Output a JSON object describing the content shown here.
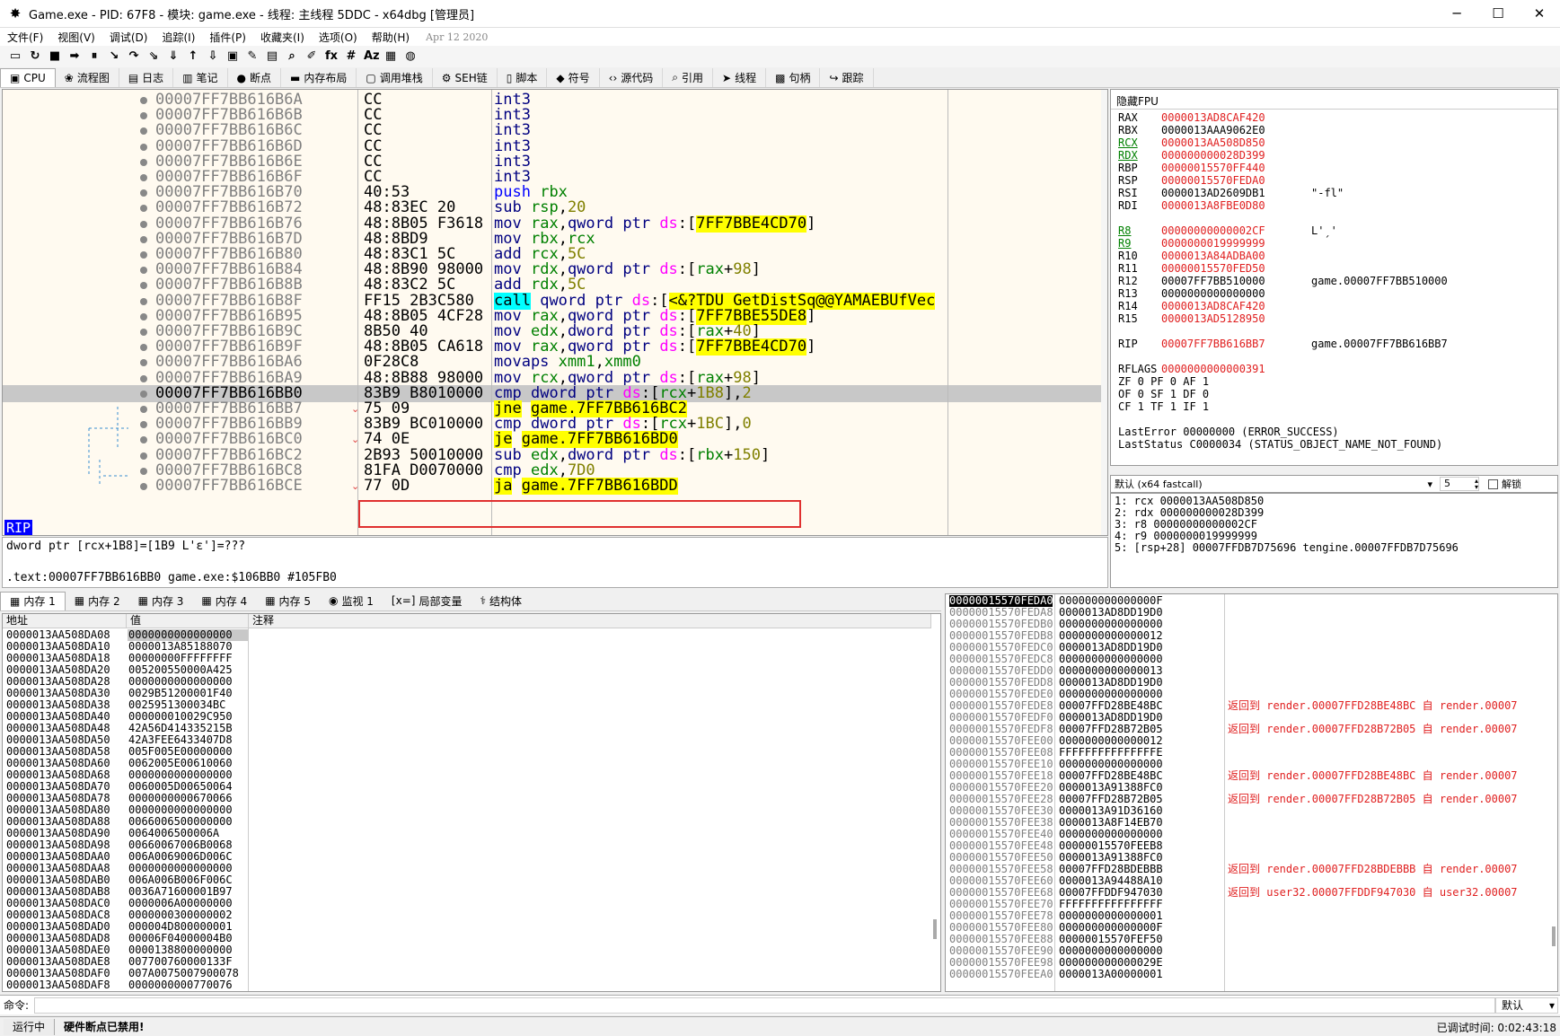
{
  "window": {
    "title": "Game.exe - PID: 67F8 - 模块: game.exe - 线程: 主线程 5DDC - x64dbg [管理员]",
    "minimize": "─",
    "maximize": "☐",
    "close": "✕"
  },
  "menu": {
    "items": [
      "文件(F)",
      "视图(V)",
      "调试(D)",
      "追踪(I)",
      "插件(P)",
      "收藏夹(I)",
      "选项(O)",
      "帮助(H)"
    ],
    "date": "Apr 12 2020"
  },
  "toolbar": {
    "icons": [
      "open-icon",
      "restart-icon",
      "stop-icon",
      "run-icon",
      "pause-icon",
      "step-into-icon",
      "step-over-icon",
      "trace-into-icon",
      "trace-over-icon",
      "execute-till-return-icon",
      "run-to-user-code-icon",
      "scylla-icon",
      "patch-icon",
      "comment-icon",
      "label-icon",
      "bookmark-icon",
      "function-icon",
      "hash-icon",
      "font-icon",
      "calculator-icon",
      "globe-icon"
    ],
    "glyphs": [
      "▭",
      "↻",
      "■",
      "➡",
      "⏸",
      "↘",
      "↷",
      "⇘",
      "⇓",
      "↑",
      "⇩",
      "▣",
      "✎",
      "▤",
      "⌕",
      "✐",
      "fx",
      "#",
      "Aᴢ",
      "▦",
      "◍"
    ]
  },
  "tabs": [
    {
      "label": "CPU",
      "icon": "▣"
    },
    {
      "label": "流程图",
      "icon": "❀"
    },
    {
      "label": "日志",
      "icon": "▤"
    },
    {
      "label": "笔记",
      "icon": "▥"
    },
    {
      "label": "断点",
      "icon": "●"
    },
    {
      "label": "内存布局",
      "icon": "▬"
    },
    {
      "label": "调用堆栈",
      "icon": "▢"
    },
    {
      "label": "SEH链",
      "icon": "⚙"
    },
    {
      "label": "脚本",
      "icon": "▯"
    },
    {
      "label": "符号",
      "icon": "◆"
    },
    {
      "label": "源代码",
      "icon": "‹›"
    },
    {
      "label": "引用",
      "icon": "⌕"
    },
    {
      "label": "线程",
      "icon": "➤"
    },
    {
      "label": "句柄",
      "icon": "▩"
    },
    {
      "label": "跟踪",
      "icon": "↪"
    }
  ],
  "disasm": [
    {
      "addr": "00007FF7BB616B6A",
      "bytes": "CC",
      "dis": "int3"
    },
    {
      "addr": "00007FF7BB616B6B",
      "bytes": "CC",
      "dis": "int3"
    },
    {
      "addr": "00007FF7BB616B6C",
      "bytes": "CC",
      "dis": "int3"
    },
    {
      "addr": "00007FF7BB616B6D",
      "bytes": "CC",
      "dis": "int3"
    },
    {
      "addr": "00007FF7BB616B6E",
      "bytes": "CC",
      "dis": "int3"
    },
    {
      "addr": "00007FF7BB616B6F",
      "bytes": "CC",
      "dis": "int3"
    },
    {
      "addr": "00007FF7BB616B70",
      "bytes": "40:53",
      "dis": "push rbx"
    },
    {
      "addr": "00007FF7BB616B72",
      "bytes": "48:83EC 20",
      "dis": "sub rsp,20"
    },
    {
      "addr": "00007FF7BB616B76",
      "bytes": "48:8B05 F3618",
      "dis": "mov rax,qword ptr ds:[7FF7BBE4CD70]"
    },
    {
      "addr": "00007FF7BB616B7D",
      "bytes": "48:8BD9",
      "dis": "mov rbx,rcx"
    },
    {
      "addr": "00007FF7BB616B80",
      "bytes": "48:83C1 5C",
      "dis": "add rcx,5C"
    },
    {
      "addr": "00007FF7BB616B84",
      "bytes": "48:8B90 98000",
      "dis": "mov rdx,qword ptr ds:[rax+98]"
    },
    {
      "addr": "00007FF7BB616B8B",
      "bytes": "48:83C2 5C",
      "dis": "add rdx,5C"
    },
    {
      "addr": "00007FF7BB616B8F",
      "bytes": "FF15 2B3C580",
      "dis": "call qword ptr ds:[<&?TDU_GetDistSq@@YAMAEBUfVec"
    },
    {
      "addr": "00007FF7BB616B95",
      "bytes": "48:8B05 4CF28",
      "dis": "mov rax,qword ptr ds:[7FF7BBE55DE8]"
    },
    {
      "addr": "00007FF7BB616B9C",
      "bytes": "8B50 40",
      "dis": "mov edx,dword ptr ds:[rax+40]"
    },
    {
      "addr": "00007FF7BB616B9F",
      "bytes": "48:8B05 CA618",
      "dis": "mov rax,qword ptr ds:[7FF7BBE4CD70]"
    },
    {
      "addr": "00007FF7BB616BA6",
      "bytes": "0F28C8",
      "dis": "movaps xmm1,xmm0"
    },
    {
      "addr": "00007FF7BB616BA9",
      "bytes": "48:8B88 98000",
      "dis": "mov rcx,qword ptr ds:[rax+98]"
    },
    {
      "addr": "00007FF7BB616BB0",
      "bytes": "83B9 B8010000",
      "dis": "cmp dword ptr ds:[rcx+1B8],2"
    },
    {
      "addr": "00007FF7BB616BB7",
      "bytes": "75 09",
      "dis": "jne game.7FF7BB616BC2"
    },
    {
      "addr": "00007FF7BB616BB9",
      "bytes": "83B9 BC010000",
      "dis": "cmp dword ptr ds:[rcx+1BC],0"
    },
    {
      "addr": "00007FF7BB616BC0",
      "bytes": "74 0E",
      "dis": "je game.7FF7BB616BD0"
    },
    {
      "addr": "00007FF7BB616BC2",
      "bytes": "2B93 50010000",
      "dis": "sub edx,dword ptr ds:[rbx+150]"
    },
    {
      "addr": "00007FF7BB616BC8",
      "bytes": "81FA D0070000",
      "dis": "cmp edx,7D0"
    },
    {
      "addr": "00007FF7BB616BCE",
      "bytes": "77 0D",
      "dis": "ja game.7FF7BB616BDD"
    }
  ],
  "rip_label": "RIP",
  "info": {
    "line1": "dword ptr [rcx+1B8]=[1B9 L'ε']=???",
    "line2": ".text:00007FF7BB616BB0 game.exe:$106BB0 #105FB0"
  },
  "regs": {
    "header": "隐藏FPU",
    "gp": [
      {
        "n": "RAX",
        "v": "0000013AD8CAF420",
        "c": ""
      },
      {
        "n": "RBX",
        "v": "0000013AAA9062E0",
        "c": ""
      },
      {
        "n": "RCX",
        "v": "0000013AA508D850",
        "c": ""
      },
      {
        "n": "RDX",
        "v": "000000000028D399",
        "c": ""
      },
      {
        "n": "RBP",
        "v": "00000015570FF440",
        "c": ""
      },
      {
        "n": "RSP",
        "v": "00000015570FEDA0",
        "c": ""
      },
      {
        "n": "RSI",
        "v": "0000013AD2609DB1",
        "c": "\"-fl\""
      },
      {
        "n": "RDI",
        "v": "0000013A8FBE0D80",
        "c": ""
      }
    ],
    "ext": [
      {
        "n": "R8",
        "v": "00000000000002CF",
        "c": "L'ˏ'"
      },
      {
        "n": "R9",
        "v": "0000000019999999",
        "c": ""
      },
      {
        "n": "R10",
        "v": "0000013A84ADBA00",
        "c": ""
      },
      {
        "n": "R11",
        "v": "00000015570FED50",
        "c": ""
      },
      {
        "n": "R12",
        "v": "00007FF7BB510000",
        "c": "game.00007FF7BB510000"
      },
      {
        "n": "R13",
        "v": "0000000000000000",
        "c": ""
      },
      {
        "n": "R14",
        "v": "0000013AD8CAF420",
        "c": ""
      },
      {
        "n": "R15",
        "v": "0000013AD5128950",
        "c": ""
      }
    ],
    "rip": {
      "n": "RIP",
      "v": "00007FF7BB616BB7",
      "c": "game.00007FF7BB616BB7"
    },
    "rflags": {
      "n": "RFLAGS",
      "v": "0000000000000391"
    },
    "flags": [
      "ZF 0   PF 0   AF 1",
      "OF 0   SF 1   DF 0",
      "CF 1   TF 1   IF 1"
    ],
    "lasterror": "LastError  00000000 (ERROR_SUCCESS)",
    "laststatus": "LastStatus C0000034 (STATUS_OBJECT_NAME_NOT_FOUND)"
  },
  "callconv": {
    "value": "默认 (x64 fastcall)",
    "count": "5",
    "unlock": "解锁"
  },
  "args": [
    "1: rcx 0000013AA508D850",
    "2: rdx 000000000028D399",
    "3: r8 00000000000002CF",
    "4: r9 0000000019999999",
    "5: [rsp+28] 00007FFDB7D75696 tengine.00007FFDB7D75696"
  ],
  "btabs": [
    {
      "label": "内存 1",
      "icon": "▦"
    },
    {
      "label": "内存 2",
      "icon": "▦"
    },
    {
      "label": "内存 3",
      "icon": "▦"
    },
    {
      "label": "内存 4",
      "icon": "▦"
    },
    {
      "label": "内存 5",
      "icon": "▦"
    },
    {
      "label": "监视 1",
      "icon": "◉"
    },
    {
      "label": "局部变量",
      "icon": "[x=]"
    },
    {
      "label": "结构体",
      "icon": "⚕"
    }
  ],
  "dump": {
    "headers": [
      "地址",
      "值",
      "注释"
    ],
    "rows": [
      [
        "0000013AA508DA08",
        "0000000000000000"
      ],
      [
        "0000013AA508DA10",
        "0000013A85188070"
      ],
      [
        "0000013AA508DA18",
        "00000000FFFFFFFF"
      ],
      [
        "0000013AA508DA20",
        "005200550000A425"
      ],
      [
        "0000013AA508DA28",
        "0000000000000000"
      ],
      [
        "0000013AA508DA30",
        "0029B51200001F40"
      ],
      [
        "0000013AA508DA38",
        "0025951300034BC"
      ],
      [
        "0000013AA508DA40",
        "000000010029C950"
      ],
      [
        "0000013AA508DA48",
        "42A56D414335215B"
      ],
      [
        "0000013AA508DA50",
        "42A3FEE6433407D8"
      ],
      [
        "0000013AA508DA58",
        "005F005E00000000"
      ],
      [
        "0000013AA508DA60",
        "0062005E00610060"
      ],
      [
        "0000013AA508DA68",
        "0000000000000000"
      ],
      [
        "0000013AA508DA70",
        "0060005D00650064"
      ],
      [
        "0000013AA508DA78",
        "0000000000670066"
      ],
      [
        "0000013AA508DA80",
        "0000000000000000"
      ],
      [
        "0000013AA508DA88",
        "0066006500000000"
      ],
      [
        "0000013AA508DA90",
        "0064006500006A"
      ],
      [
        "0000013AA508DA98",
        "00660067006B0068"
      ],
      [
        "0000013AA508DAA0",
        "006A0069006D006C"
      ],
      [
        "0000013AA508DAA8",
        "0000000000000000"
      ],
      [
        "0000013AA508DAB0",
        "006A006B006F006C"
      ],
      [
        "0000013AA508DAB8",
        "0036A71600001B97"
      ],
      [
        "0000013AA508DAC0",
        "0000006A00000000"
      ],
      [
        "0000013AA508DAC8",
        "0000000300000002"
      ],
      [
        "0000013AA508DAD0",
        "000004D800000001"
      ],
      [
        "0000013AA508DAD8",
        "00006F04000004B0"
      ],
      [
        "0000013AA508DAE0",
        "0000138800000000"
      ],
      [
        "0000013AA508DAE8",
        "007700760000133F"
      ],
      [
        "0000013AA508DAF0",
        "007A0075007900078"
      ],
      [
        "0000013AA508DAF8",
        "0000000000770076"
      ]
    ]
  },
  "stack": [
    [
      "00000015570FEDA0",
      "000000000000000F",
      ""
    ],
    [
      "00000015570FEDA8",
      "0000013AD8DD19D0",
      ""
    ],
    [
      "00000015570FEDB0",
      "0000000000000000",
      ""
    ],
    [
      "00000015570FEDB8",
      "0000000000000012",
      ""
    ],
    [
      "00000015570FEDC0",
      "0000013AD8DD19D0",
      ""
    ],
    [
      "00000015570FEDC8",
      "0000000000000000",
      ""
    ],
    [
      "00000015570FEDD0",
      "0000000000000013",
      ""
    ],
    [
      "00000015570FEDD8",
      "0000013AD8DD19D0",
      ""
    ],
    [
      "00000015570FEDE0",
      "0000000000000000",
      ""
    ],
    [
      "00000015570FEDE8",
      "00007FFD28BE48BC",
      "返回到 render.00007FFD28BE48BC 自 render.00007"
    ],
    [
      "00000015570FEDF0",
      "0000013AD8DD19D0",
      ""
    ],
    [
      "00000015570FEDF8",
      "00007FFD28B72B05",
      "返回到 render.00007FFD28B72B05 自 render.00007"
    ],
    [
      "00000015570FEE00",
      "0000000000000012",
      ""
    ],
    [
      "00000015570FEE08",
      "FFFFFFFFFFFFFFFE",
      ""
    ],
    [
      "00000015570FEE10",
      "0000000000000000",
      ""
    ],
    [
      "00000015570FEE18",
      "00007FFD28BE48BC",
      "返回到 render.00007FFD28BE48BC 自 render.00007"
    ],
    [
      "00000015570FEE20",
      "0000013A91388FC0",
      ""
    ],
    [
      "00000015570FEE28",
      "00007FFD28B72B05",
      "返回到 render.00007FFD28B72B05 自 render.00007"
    ],
    [
      "00000015570FEE30",
      "0000013A91D36160",
      ""
    ],
    [
      "00000015570FEE38",
      "0000013A8F14EB70",
      ""
    ],
    [
      "00000015570FEE40",
      "0000000000000000",
      ""
    ],
    [
      "00000015570FEE48",
      "00000015570FEEB8",
      ""
    ],
    [
      "00000015570FEE50",
      "0000013A91388FC0",
      ""
    ],
    [
      "00000015570FEE58",
      "00007FFD28BDEBBB",
      "返回到 render.00007FFD28BDEBBB 自 render.00007"
    ],
    [
      "00000015570FEE60",
      "0000013A94488A10",
      ""
    ],
    [
      "00000015570FEE68",
      "00007FFDDF947030",
      "返回到 user32.00007FFDDF947030 自 user32.00007"
    ],
    [
      "00000015570FEE70",
      "FFFFFFFFFFFFFFFF",
      ""
    ],
    [
      "00000015570FEE78",
      "0000000000000001",
      ""
    ],
    [
      "00000015570FEE80",
      "000000000000000F",
      ""
    ],
    [
      "00000015570FEE88",
      "00000015570FEF50",
      ""
    ],
    [
      "00000015570FEE90",
      "0000000000000000",
      ""
    ],
    [
      "00000015570FEE98",
      "000000000000029E",
      ""
    ],
    [
      "00000015570FEEA0",
      "0000013A00000001",
      ""
    ]
  ],
  "cmd": {
    "label": "命令:",
    "placeholder": "",
    "mode": "默认"
  },
  "status": {
    "state": "运行中",
    "message": "硬件断点已禁用!",
    "time": "已调试时间: 0:02:43:18"
  }
}
